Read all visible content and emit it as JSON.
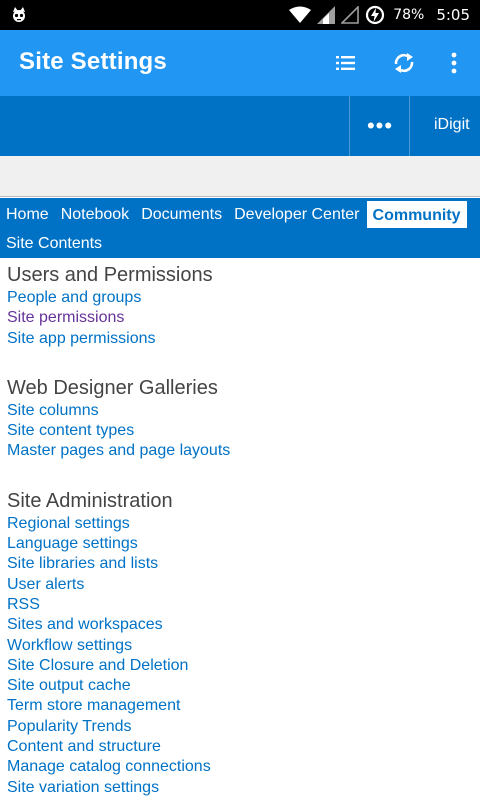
{
  "status_bar": {
    "battery": "78%",
    "time": "5:05",
    "icons": [
      "app-notification-icon",
      "wifi-icon",
      "signal-icon",
      "signal-empty-icon",
      "battery-charging-icon"
    ]
  },
  "app_bar": {
    "title": "Site Settings",
    "actions": [
      "list-icon",
      "refresh-icon",
      "overflow-menu-icon"
    ],
    "color": "#2196f3"
  },
  "ribbon": {
    "more_label": "•••",
    "user": "iDigit",
    "color": "#0072c6"
  },
  "nav": {
    "tabs": [
      "Home",
      "Notebook",
      "Documents",
      "Developer Center",
      "Community"
    ],
    "active_tab": "Community",
    "second_row": "Site Contents"
  },
  "sections": [
    {
      "heading": "Users and Permissions",
      "links": [
        "People and groups",
        "Site permissions",
        "Site app permissions"
      ]
    },
    {
      "heading": "Web Designer Galleries",
      "links": [
        "Site columns",
        "Site content types",
        "Master pages and page layouts"
      ]
    },
    {
      "heading": "Site Administration",
      "links": [
        "Regional settings",
        "Language settings",
        "Site libraries and lists",
        "User alerts",
        "RSS",
        "Sites and workspaces",
        "Workflow settings",
        "Site Closure and Deletion",
        "Site output cache",
        "Term store management",
        "Popularity Trends",
        "Content and structure",
        "Manage catalog connections",
        "Site variation settings"
      ]
    }
  ],
  "colors": {
    "link": "#0072c6",
    "visited_link": "#663399",
    "heading": "#444444"
  }
}
